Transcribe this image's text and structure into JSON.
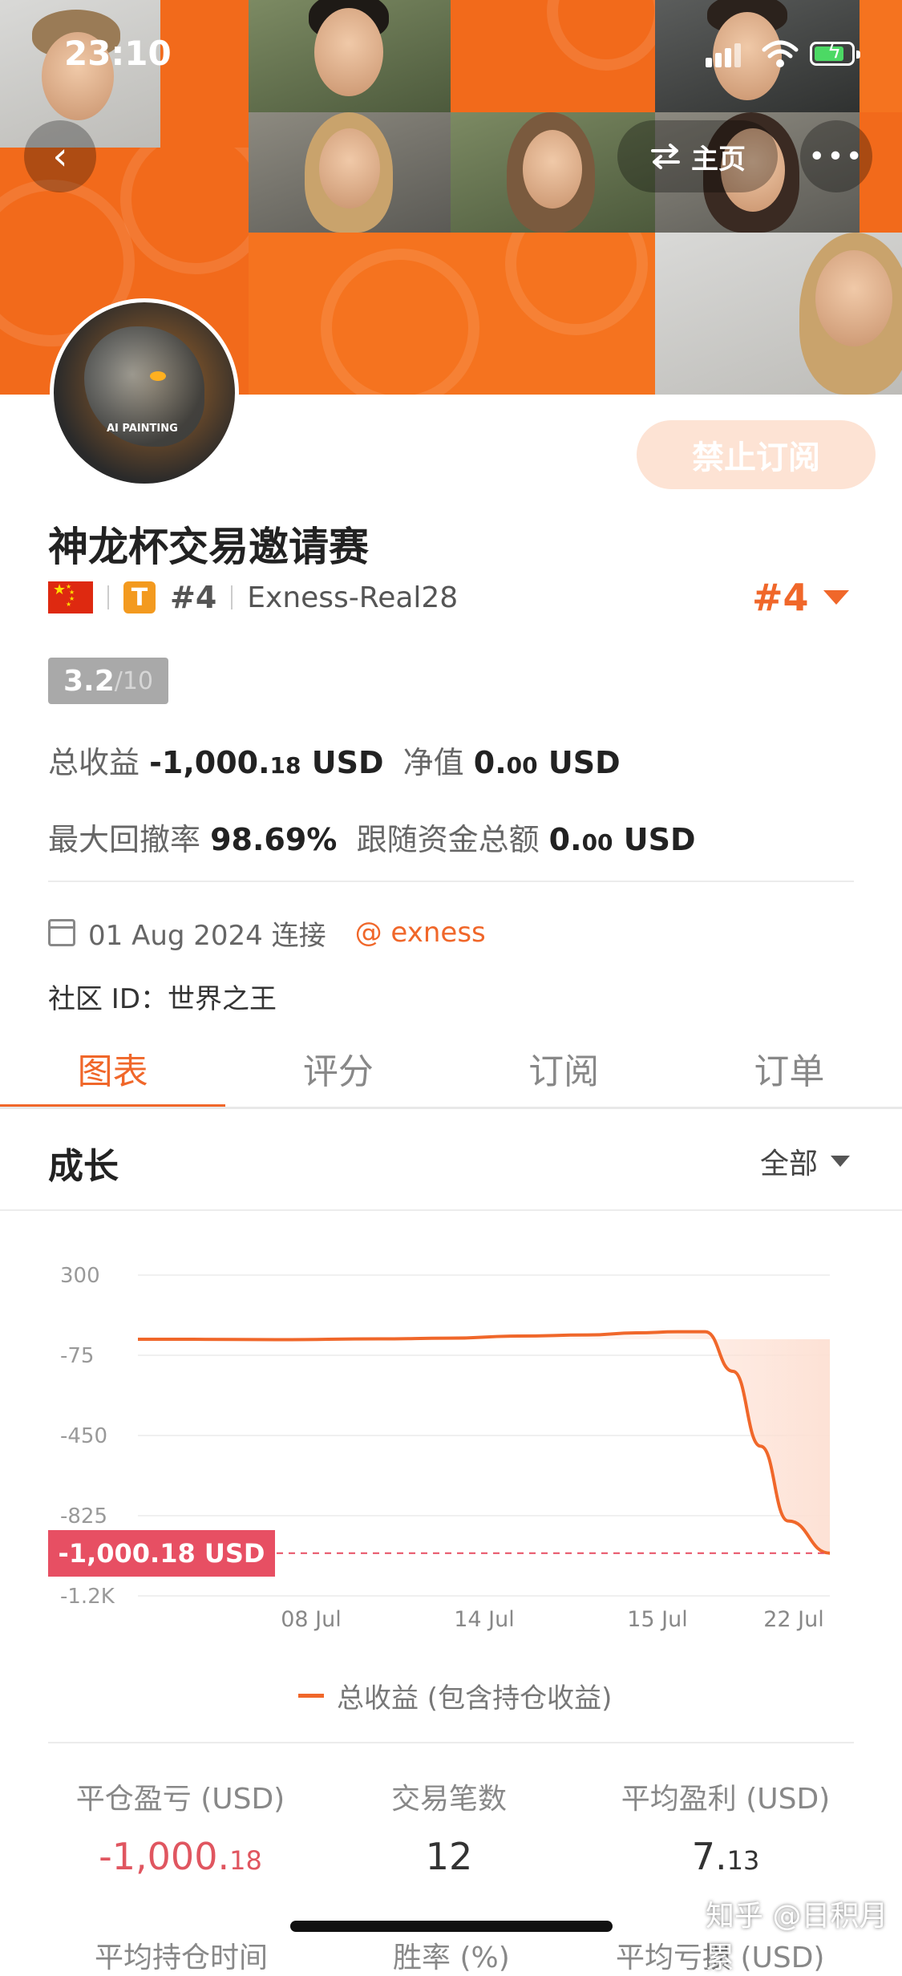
{
  "status_bar": {
    "time": "23:10"
  },
  "header": {
    "home_label": "主页",
    "more_label": "•••",
    "back_label": "‹"
  },
  "profile": {
    "avatar_text": "AI PAINTING",
    "subscribe_button": "禁止订阅",
    "name": "神龙杯交易邀请赛",
    "tier_badge": "T",
    "rank_inline": "#4",
    "account": "Exness-Real28",
    "rank_right": "#4",
    "score_value": "3.2",
    "score_denominator": "/10"
  },
  "stats": {
    "total_profit_label": "总收益",
    "total_profit_main": "-1,000.",
    "total_profit_decimal": "18",
    "total_profit_unit": " USD",
    "equity_label": "净值",
    "equity_main": "0.",
    "equity_decimal": "00",
    "equity_unit": " USD",
    "max_drawdown_label": "最大回撤率",
    "max_drawdown_value": "98.69%",
    "follow_funds_label": "跟随资金总额",
    "follow_funds_main": "0.",
    "follow_funds_decimal": "00",
    "follow_funds_unit": " USD"
  },
  "connection": {
    "date_text": "01 Aug 2024 连接",
    "broker": "@ exness",
    "community_id": "社区 ID：世界之王"
  },
  "tabs": [
    {
      "label": "图表",
      "active": true
    },
    {
      "label": "评分",
      "active": false
    },
    {
      "label": "订阅",
      "active": false
    },
    {
      "label": "订单",
      "active": false
    }
  ],
  "section": {
    "title": "成长",
    "filter": "全部"
  },
  "chart_data": {
    "type": "area",
    "y_ticks": [
      "300",
      "-75",
      "-450",
      "-825",
      "-1.2K"
    ],
    "ylim": [
      -1200,
      300
    ],
    "x_tick_labels": [
      "08 Jul",
      "14 Jul",
      "15 Jul",
      "22 Jul"
    ],
    "series": [
      {
        "name": "总收益 (包含持仓收益)",
        "points": [
          [
            0,
            0
          ],
          [
            0.08,
            0
          ],
          [
            0.2,
            -2
          ],
          [
            0.35,
            2
          ],
          [
            0.45,
            5
          ],
          [
            0.55,
            15
          ],
          [
            0.65,
            20
          ],
          [
            0.72,
            30
          ],
          [
            0.78,
            35
          ],
          [
            0.82,
            35
          ],
          [
            0.86,
            -150
          ],
          [
            0.9,
            -500
          ],
          [
            0.94,
            -850
          ],
          [
            1.0,
            -1000.18
          ]
        ]
      }
    ],
    "current_value_label": "-1,000.18 USD",
    "current_value": -1000.18,
    "line_color": "#f0672a",
    "fill_color": "#fde0d3",
    "ref_line_color": "#e74f63"
  },
  "legend": {
    "label": "总收益 (包含持仓收益)"
  },
  "summary": {
    "closed_pl_label": "平仓盈亏 (USD)",
    "closed_pl_main": "-1,000.",
    "closed_pl_decimal": "18",
    "trades_label": "交易笔数",
    "trades_value": "12",
    "avg_profit_label": "平均盈利 (USD)",
    "avg_profit_main": "7.",
    "avg_profit_decimal": "13",
    "avg_hold_label": "平均持仓时间",
    "win_rate_label": "胜率 (%)",
    "avg_loss_label": "平均亏损 (USD)"
  },
  "watermark": "知乎 @日积月累",
  "colors": {
    "accent": "#f0672a",
    "negative": "#e05660",
    "banner": "#f26a1b"
  }
}
